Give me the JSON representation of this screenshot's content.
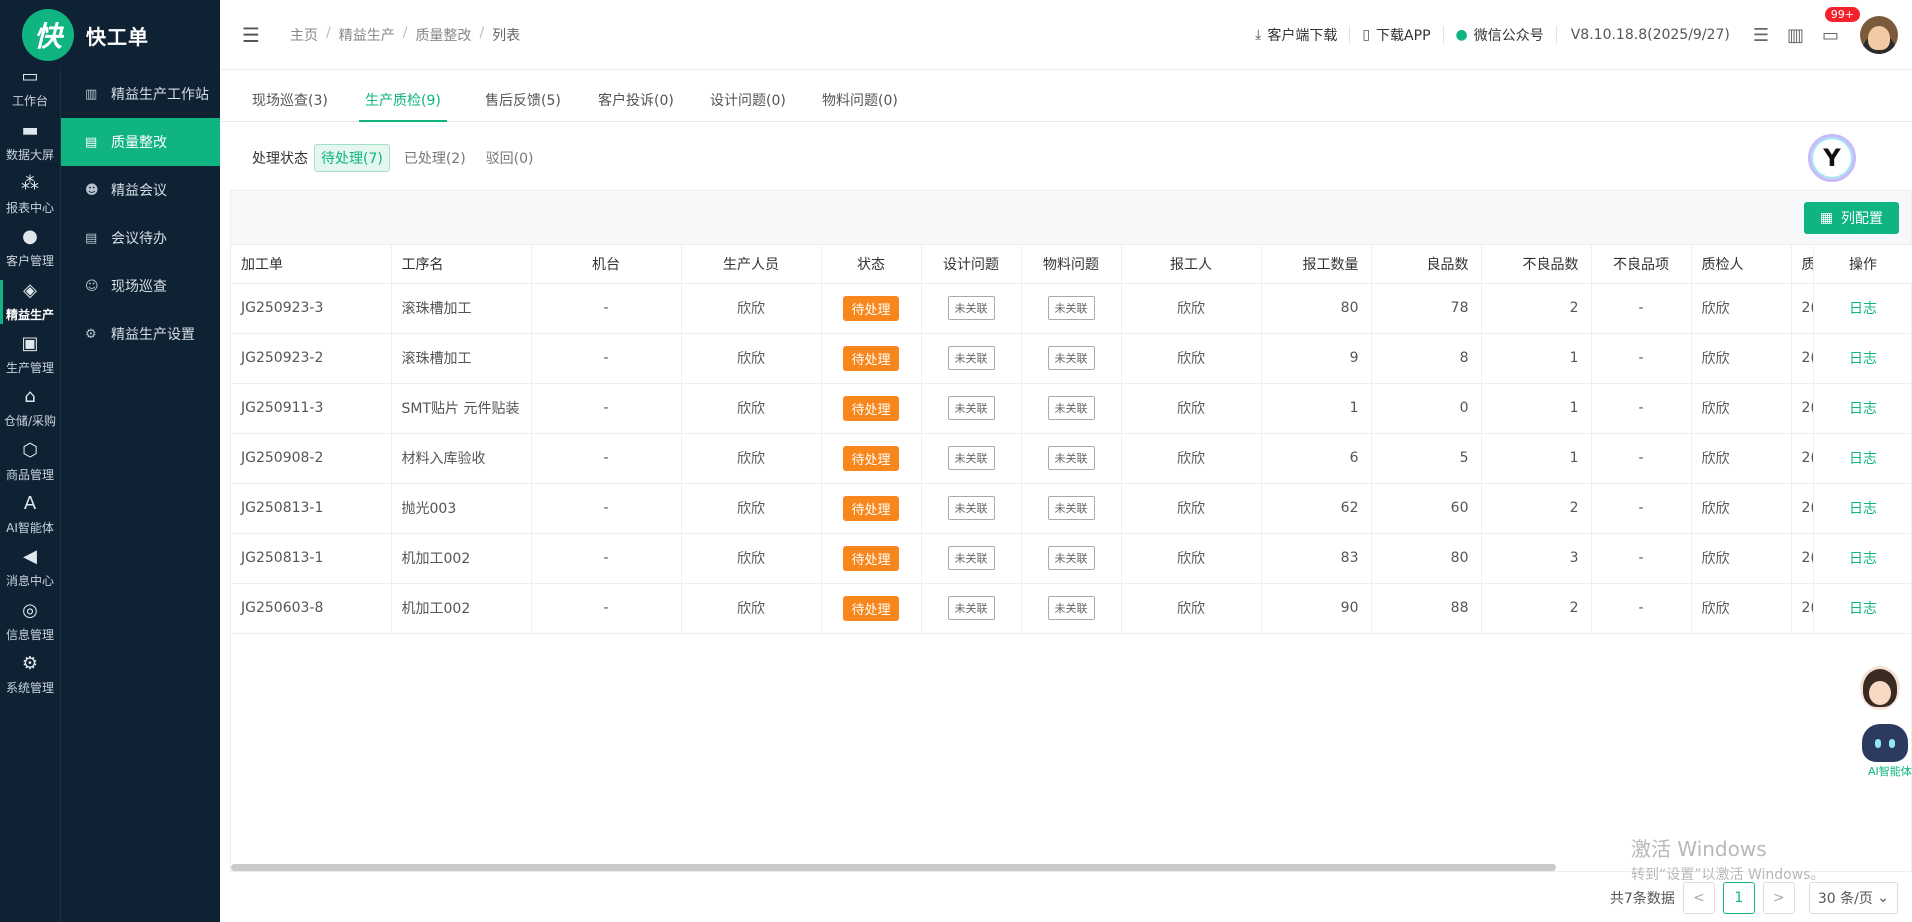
{
  "brand": {
    "logo_char": "快",
    "name": "快工单"
  },
  "rail": [
    {
      "label": "工作台",
      "icon": "monitor-icon"
    },
    {
      "label": "数据大屏",
      "icon": "screen-icon"
    },
    {
      "label": "报表中心",
      "icon": "share-icon"
    },
    {
      "label": "客户管理",
      "icon": "user-icon"
    },
    {
      "label": "精益生产",
      "icon": "layers-icon",
      "active": true
    },
    {
      "label": "生产管理",
      "icon": "box-icon"
    },
    {
      "label": "仓储/采购",
      "icon": "warehouse-icon"
    },
    {
      "label": "商品管理",
      "icon": "cube-icon"
    },
    {
      "label": "AI智能体",
      "icon": "ai-icon"
    },
    {
      "label": "消息中心",
      "icon": "megaphone-icon"
    },
    {
      "label": "信息管理",
      "icon": "info-icon"
    },
    {
      "label": "系统管理",
      "icon": "gear-icon"
    }
  ],
  "submenu": [
    {
      "label": "精益生产工作站",
      "icon": "chart-icon"
    },
    {
      "label": "质量整改",
      "icon": "list-icon",
      "active": true
    },
    {
      "label": "精益会议",
      "icon": "people-icon"
    },
    {
      "label": "会议待办",
      "icon": "list-icon"
    },
    {
      "label": "现场巡查",
      "icon": "person-icon"
    },
    {
      "label": "精益生产设置",
      "icon": "gears-icon"
    }
  ],
  "breadcrumb": [
    "主页",
    "精益生产",
    "质量整改",
    "列表"
  ],
  "header": {
    "client_download": "客户端下载",
    "app_download": "下载APP",
    "wechat": "微信公众号",
    "version": "V8.10.18.8(2025/9/27)",
    "badge": "99+"
  },
  "tabs": [
    "现场巡查(3)",
    "生产质检(9)",
    "售后反馈(5)",
    "客户投诉(0)",
    "设计问题(0)",
    "物料问题(0)"
  ],
  "status": {
    "label": "处理状态",
    "options": [
      "待处理(7)",
      "已处理(2)",
      "驳回(0)"
    ]
  },
  "toolbar": {
    "column_config": "列配置"
  },
  "columns": [
    "加工单",
    "工序名",
    "机台",
    "生产人员",
    "状态",
    "设计问题",
    "物料问题",
    "报工人",
    "报工数量",
    "良品数",
    "不良品数",
    "不良品项",
    "质检人",
    "质",
    "操作"
  ],
  "rows": [
    [
      "JG250923-3",
      "滚珠槽加工",
      "-",
      "欣欣",
      "待处理",
      "未关联",
      "未关联",
      "欣欣",
      "80",
      "78",
      "2",
      "-",
      "欣欣",
      "2(",
      "日志"
    ],
    [
      "JG250923-2",
      "滚珠槽加工",
      "-",
      "欣欣",
      "待处理",
      "未关联",
      "未关联",
      "欣欣",
      "9",
      "8",
      "1",
      "-",
      "欣欣",
      "2(",
      "日志"
    ],
    [
      "JG250911-3",
      "SMT贴片 元件贴装",
      "-",
      "欣欣",
      "待处理",
      "未关联",
      "未关联",
      "欣欣",
      "1",
      "0",
      "1",
      "-",
      "欣欣",
      "2(",
      "日志"
    ],
    [
      "JG250908-2",
      "材料入库验收",
      "-",
      "欣欣",
      "待处理",
      "未关联",
      "未关联",
      "欣欣",
      "6",
      "5",
      "1",
      "-",
      "欣欣",
      "2(",
      "日志"
    ],
    [
      "JG250813-1",
      "抛光003",
      "-",
      "欣欣",
      "待处理",
      "未关联",
      "未关联",
      "欣欣",
      "62",
      "60",
      "2",
      "-",
      "欣欣",
      "2(",
      "日志"
    ],
    [
      "JG250813-1",
      "机加工002",
      "-",
      "欣欣",
      "待处理",
      "未关联",
      "未关联",
      "欣欣",
      "83",
      "80",
      "3",
      "-",
      "欣欣",
      "2(",
      "日志"
    ],
    [
      "JG250603-8",
      "机加工002",
      "-",
      "欣欣",
      "待处理",
      "未关联",
      "未关联",
      "欣欣",
      "90",
      "88",
      "2",
      "-",
      "欣欣",
      "2(",
      "日志"
    ]
  ],
  "pager": {
    "total": "共7条数据",
    "prev": "<",
    "page": "1",
    "next": ">",
    "size": "30 条/页"
  },
  "float": {
    "ai_label": "AI智能体"
  },
  "watermark": {
    "line1": "激活 Windows",
    "line2": "转到“设置”以激活 Windows。"
  },
  "colors": {
    "accent": "#0fb481",
    "sidebar": "#0f2233",
    "pending": "#f7861c"
  }
}
